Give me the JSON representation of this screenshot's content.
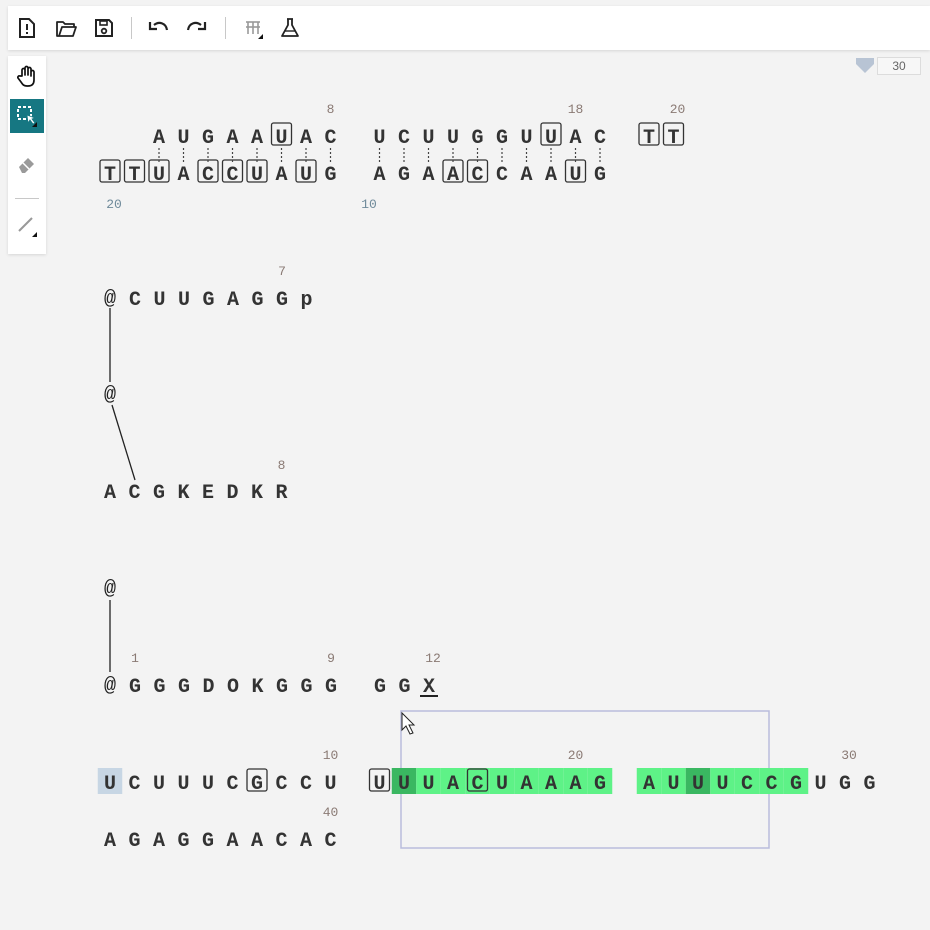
{
  "toolbar": {
    "icons": [
      "file-info-icon",
      "folder-open-icon",
      "save-icon",
      "undo-icon",
      "redo-icon",
      "sequence-layout-icon",
      "flask-icon"
    ]
  },
  "left_tools": [
    "hand-icon",
    "select-rectangle-icon",
    "eraser-icon",
    "bond-line-icon"
  ],
  "zoom": {
    "value": "30"
  },
  "colors": {
    "accent": "#167782",
    "highlight": "#5ef287",
    "highlight_dark": "#3ab761",
    "selection_border": "#b9bddc"
  },
  "duplex": {
    "top": [
      "A",
      "U",
      "G",
      "A",
      "A",
      "U",
      "A",
      "C",
      "",
      "U",
      "C",
      "U",
      "U",
      "G",
      "G",
      "U",
      "U",
      "A",
      "C",
      "",
      "T",
      "T"
    ],
    "top_boxed": [
      5,
      16,
      20,
      21
    ],
    "top_numbers": [
      "8",
      "18",
      "20"
    ],
    "bottom": [
      "T",
      "T",
      "U",
      "A",
      "C",
      "C",
      "U",
      "A",
      "U",
      "G",
      "",
      "A",
      "G",
      "A",
      "A",
      "C",
      "C",
      "A",
      "A",
      "U",
      "G"
    ],
    "bottom_boxed": [
      0,
      1,
      2,
      4,
      5,
      6,
      8,
      14,
      15,
      19
    ],
    "bottom_numbers": [
      "20",
      "10"
    ]
  },
  "chain1": {
    "anchor": "@",
    "seq": [
      "C",
      "U",
      "U",
      "G",
      "A",
      "G",
      "G",
      "p"
    ],
    "number": "7"
  },
  "middle_anchor": "@",
  "chain2": {
    "seq": [
      "A",
      "C",
      "G",
      "K",
      "E",
      "D",
      "K",
      "R"
    ],
    "number": "8"
  },
  "chain3": {
    "anchor_top": "@",
    "anchor": "@",
    "seq": [
      "G",
      "G",
      "G",
      "D",
      "O",
      "K",
      "G",
      "G",
      "G",
      "",
      "G",
      "G",
      "X"
    ],
    "numbers": [
      "1",
      "9",
      "12"
    ]
  },
  "rna": {
    "seq": [
      "U",
      "C",
      "U",
      "U",
      "U",
      "C",
      "G",
      "C",
      "C",
      "U",
      "",
      "U",
      "U",
      "U",
      "A",
      "C",
      "U",
      "A",
      "A",
      "A",
      "G",
      "",
      "A",
      "U",
      "U",
      "U",
      "C",
      "C",
      "G",
      "U",
      "G",
      "G"
    ],
    "boxed": [
      6,
      11,
      15
    ],
    "numbers": [
      "10",
      "20",
      "30"
    ],
    "line2": [
      "A",
      "G",
      "A",
      "G",
      "G",
      "A",
      "A",
      "C",
      "A",
      "C"
    ],
    "line2_number": "40"
  }
}
